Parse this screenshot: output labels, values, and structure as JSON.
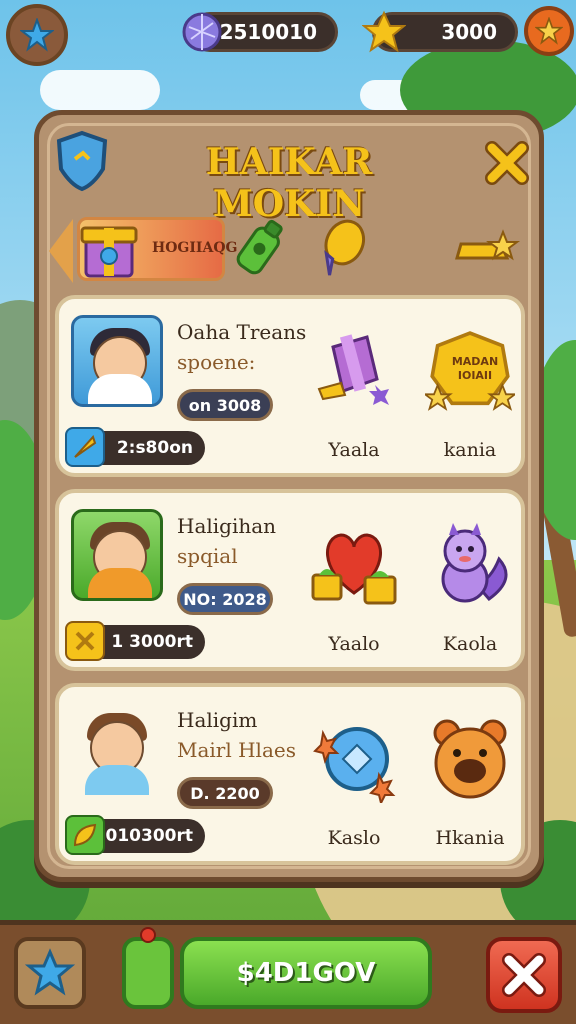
{
  "hud": {
    "gems_value": "2510010",
    "coins_value": "3000",
    "left_icon": "star-badge-icon",
    "right_icon": "star-coin-icon"
  },
  "panel": {
    "title": "HAIKAR MOKIN",
    "close_icon": "close-icon",
    "shield_icon": "shield-icon"
  },
  "tabs": {
    "active_label": "HOGIIAQG",
    "icons": [
      "gift-box-icon",
      "green-bottle-icon",
      "balloon-icon",
      "gold-bar-icon"
    ]
  },
  "cards": [
    {
      "name_line1": "Oaha Treans",
      "name_line2": "spoene:",
      "badge": "on 3008",
      "reward": "2:s80on",
      "items": [
        {
          "label": "Yaala",
          "icon": "purple-box-icon"
        },
        {
          "label": "kania",
          "icon": "gold-badge-icon",
          "badge_text": "MADAN IOIAII"
        }
      ]
    },
    {
      "name_line1": "Haligihan",
      "name_line2": "spqial",
      "badge": "NO: 2028",
      "reward": "1 3000rt",
      "items": [
        {
          "label": "Yaalo",
          "icon": "red-heart-gift-icon"
        },
        {
          "label": "Kaola",
          "icon": "purple-squirrel-icon"
        }
      ]
    },
    {
      "name_line1": "Haligim",
      "name_line2": "Mairl Hlaes",
      "badge": "D. 2200",
      "reward": "010300rt",
      "items": [
        {
          "label": "Kaslo",
          "icon": "blue-gem-icon"
        },
        {
          "label": "Hkania",
          "icon": "orange-bear-icon"
        }
      ]
    }
  ],
  "bottom": {
    "main_label": "$4D1GOV",
    "left_icon": "blue-star-icon",
    "close_icon": "close-x-icon"
  },
  "colors": {
    "panel": "#b49270",
    "title": "#f5c21a",
    "green_button": "#6ac43c",
    "red_button": "#cf3320"
  }
}
